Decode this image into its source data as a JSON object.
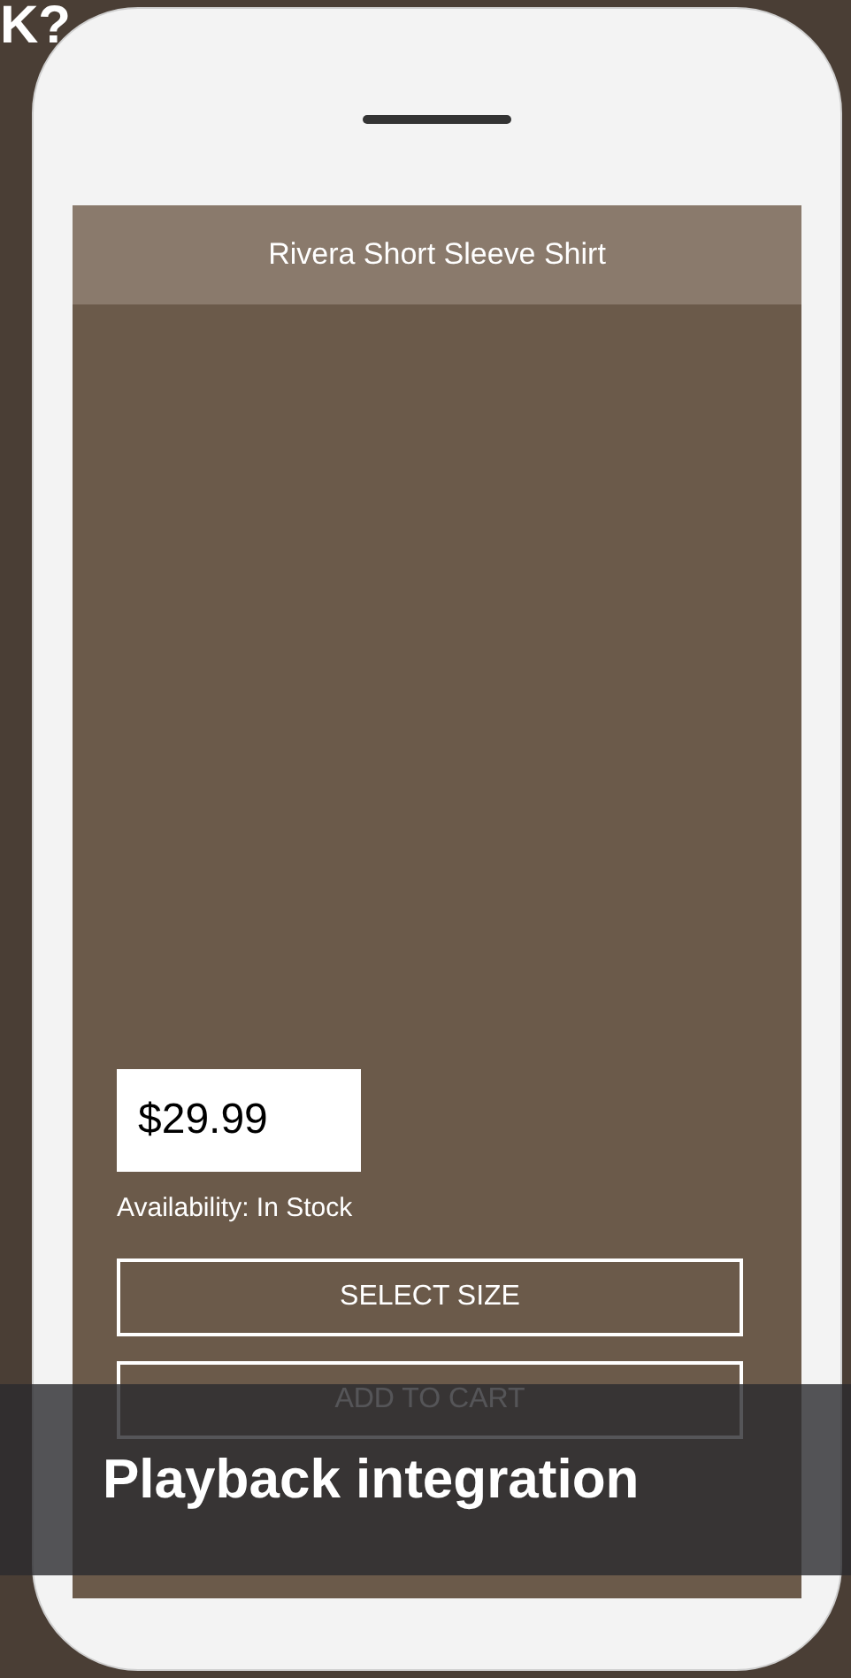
{
  "page_heading": "K?",
  "screen": {
    "title": "Rivera Short Sleeve Shirt",
    "price": "$29.99",
    "availability": "Availability: In Stock",
    "buttons": [
      {
        "label": "SELECT SIZE"
      },
      {
        "label": "ADD TO CART"
      }
    ]
  },
  "caption": "Playback integration"
}
